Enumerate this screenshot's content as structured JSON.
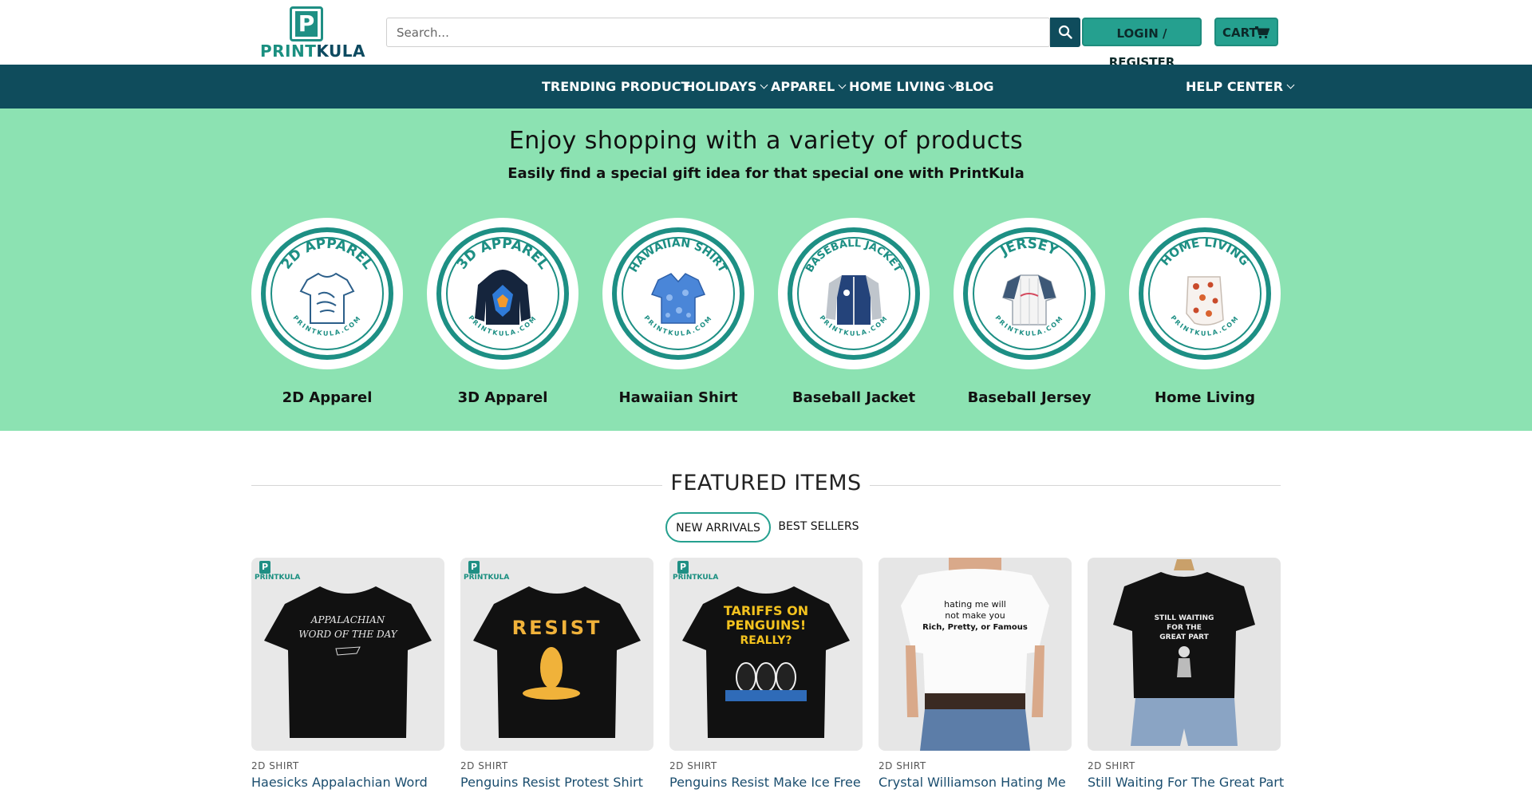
{
  "header": {
    "logo_letter": "P",
    "logo_text_1": "PRINT",
    "logo_text_2": "KULA",
    "search_placeholder": "Search...",
    "login_label": "LOGIN / REGISTER",
    "cart_label": "CART"
  },
  "nav": {
    "items": [
      {
        "label": "TRENDING PRODUCT",
        "dropdown": false
      },
      {
        "label": "HOLIDAYS",
        "dropdown": true
      },
      {
        "label": "APPAREL",
        "dropdown": true
      },
      {
        "label": "HOME LIVING",
        "dropdown": true
      },
      {
        "label": "BLOG",
        "dropdown": false
      }
    ],
    "help_center": "HELP CENTER"
  },
  "hero": {
    "title": "Enjoy shopping with a variety of products",
    "subtitle": "Easily find a special gift idea for that special one with PrintKula",
    "categories": [
      {
        "badge": "2D APPAREL",
        "label": "2D Apparel",
        "icon": "tshirt-icon"
      },
      {
        "badge": "3D APPAREL",
        "label": "3D Apparel",
        "icon": "hoodie-icon"
      },
      {
        "badge": "HAWAIIAN SHIRT",
        "label": "Hawaiian Shirt",
        "icon": "hawaiian-shirt-icon"
      },
      {
        "badge": "BASEBALL JACKET",
        "label": "Baseball Jacket",
        "icon": "jacket-icon"
      },
      {
        "badge": "JERSEY",
        "label": "Baseball Jersey",
        "icon": "jersey-icon"
      },
      {
        "badge": "HOME LIVING",
        "label": "Home Living",
        "icon": "blanket-icon"
      }
    ],
    "badge_footer": "PRINTKULA.COM"
  },
  "featured": {
    "title": "FEATURED ITEMS",
    "tabs": [
      {
        "label": "NEW ARRIVALS",
        "active": true
      },
      {
        "label": "BEST SELLERS",
        "active": false
      }
    ],
    "products": [
      {
        "category": "2D SHIRT",
        "name": "Haesicks Appalachian Word",
        "shirt_text": "APPALACHIAN WORD OF THE DAY",
        "badge": true,
        "model": false
      },
      {
        "category": "2D SHIRT",
        "name": "Penguins Resist Protest Shirt",
        "shirt_text": "RESIST",
        "badge": true,
        "model": false
      },
      {
        "category": "2D SHIRT",
        "name": "Penguins Resist Make Ice Free",
        "shirt_text": "TARIFFS ON PENGUINS! REALLY?",
        "badge": true,
        "model": false
      },
      {
        "category": "2D SHIRT",
        "name": "Crystal Williamson Hating Me",
        "shirt_text": "hating me will not make you Rich, Pretty, or Famous",
        "badge": false,
        "model": true
      },
      {
        "category": "2D SHIRT",
        "name": "Still Waiting For The Great Part",
        "shirt_text": "STILL WAITING FOR THE GREAT PART",
        "badge": false,
        "model": true
      }
    ],
    "badge_letter": "P",
    "badge_text": "PRINTKULA"
  },
  "colors": {
    "nav_bg": "#0f4c5c",
    "accent": "#25a08f",
    "hero_bg": "#8ce2b2"
  }
}
